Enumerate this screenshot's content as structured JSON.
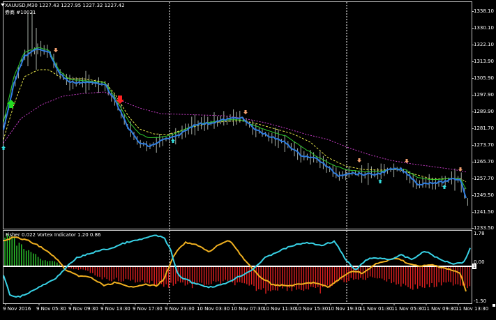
{
  "header": {
    "symbol_line": "XAUUSD,M30  1227.43 1227.95 1227.32 1227.42",
    "sub_line": "券商    #10021"
  },
  "indicator_header": "Fisher 0.022  Vortex Indicator 1.20 0.86",
  "price_axis": [
    "1338.10",
    "1330.10",
    "1322.10",
    "1313.90",
    "1305.90",
    "1297.90",
    "1289.90",
    "1281.70",
    "1273.70",
    "1265.70",
    "1257.70",
    "1249.50",
    "1241.50",
    "1233.50"
  ],
  "indicator_axis": [
    "1.78",
    "0.00",
    "1",
    "-1.50"
  ],
  "time_axis": [
    "9 Nov 2016",
    "9 Nov 05:30",
    "9 Nov 09:30",
    "9 Nov 13:30",
    "9 Nov 17:30",
    "9 Nov 23:30",
    "10 Nov 03:30",
    "10 Nov 07:30",
    "10 Nov 11:30",
    "10 Nov 15:30",
    "10 Nov 19:30",
    "11 Nov 01:30",
    "11 Nov 05:30",
    "11 Nov 09:30",
    "11 Nov 13:30"
  ],
  "colors": {
    "background": "#000000",
    "grid_dash": "#ffffff",
    "price_blue": "#2e7de0",
    "ma_green": "#2ecc2e",
    "ma_yellow_dash": "#e6e64a",
    "ma_magenta_dash": "#c83cc8",
    "candles": "#a8b0a8",
    "fisher_pos": "#2ecc2e",
    "fisher_neg": "#e02020",
    "vortex_cyan": "#38d2e6",
    "vortex_orange": "#f0b020",
    "signal_up_cyan": "#33dddd",
    "signal_up_green": "#22dd22",
    "signal_down_orange": "#f2a070",
    "signal_down_red": "#ff2020"
  }
}
